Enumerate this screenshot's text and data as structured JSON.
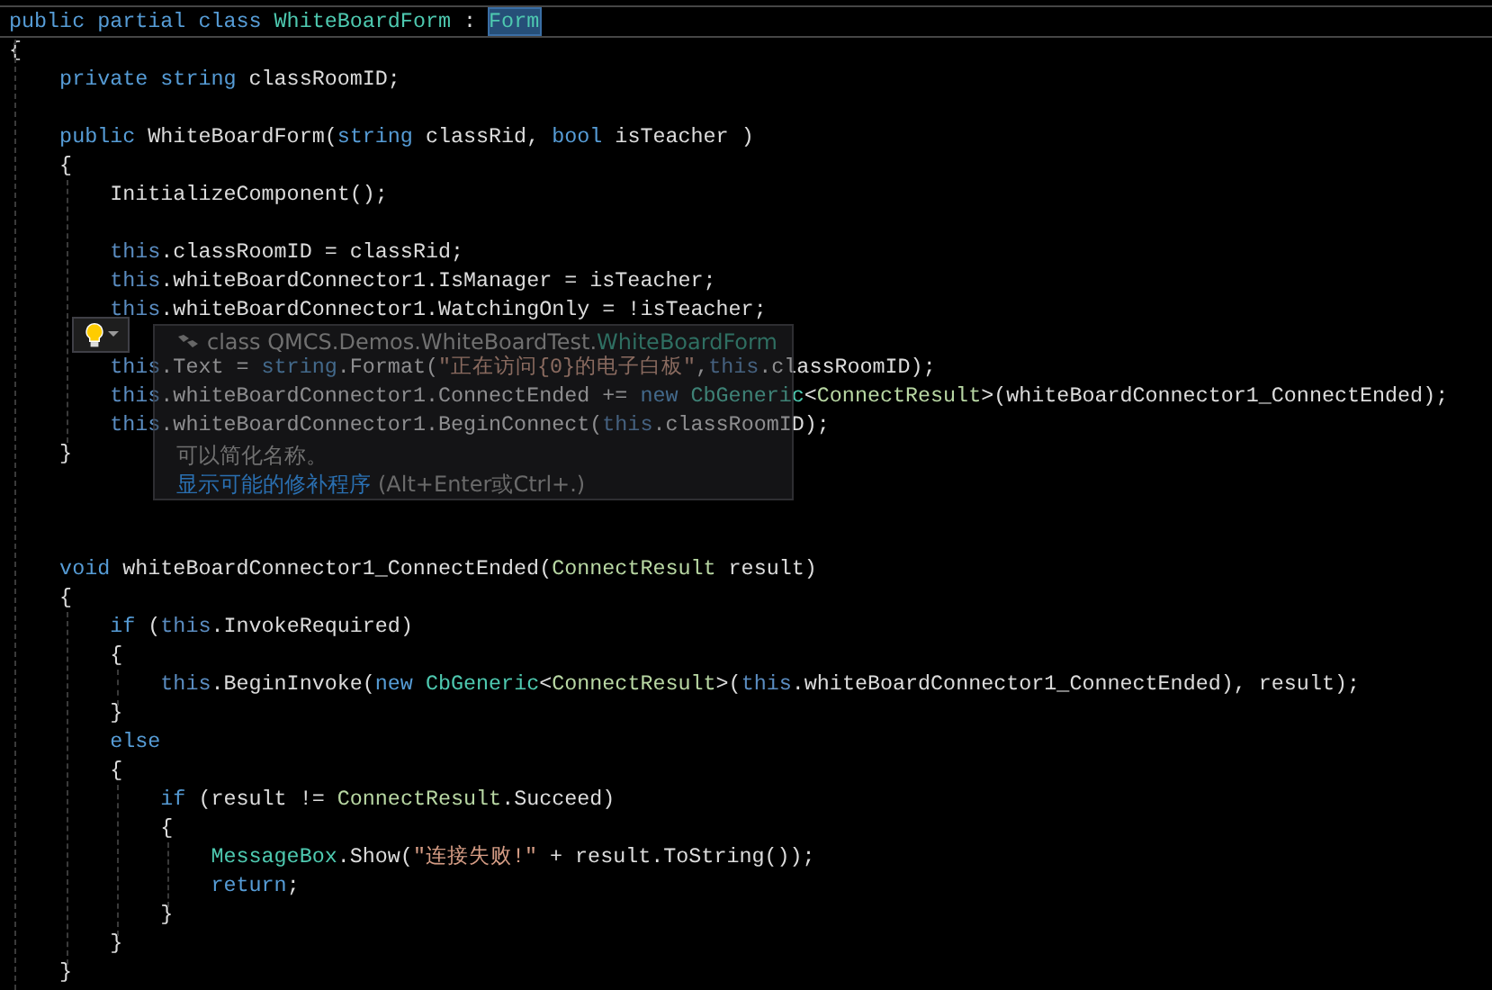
{
  "editor": {
    "lines": [
      {
        "kind": "current",
        "tokens": [
          {
            "text": "public partial class ",
            "kind": "keyword"
          },
          {
            "text": "WhiteBoardForm",
            "kind": "type"
          },
          {
            "text": " : ",
            "kind": "plain"
          },
          {
            "text": "Form",
            "kind": "selected-type"
          }
        ]
      },
      {
        "kind": "code",
        "tokens": [
          {
            "text": "{",
            "kind": "plain"
          }
        ]
      },
      {
        "kind": "code",
        "tokens": [
          {
            "text": "    private string",
            "kind": "keyword"
          },
          {
            "text": " classRoomID;",
            "kind": "plain"
          }
        ]
      },
      {
        "kind": "blank"
      },
      {
        "kind": "code",
        "tokens": [
          {
            "text": "    public",
            "kind": "keyword"
          },
          {
            "text": " WhiteBoardForm(",
            "kind": "plain"
          },
          {
            "text": "string",
            "kind": "keyword"
          },
          {
            "text": " classRid, ",
            "kind": "plain"
          },
          {
            "text": "bool",
            "kind": "keyword"
          },
          {
            "text": " isTeacher )",
            "kind": "plain"
          }
        ]
      },
      {
        "kind": "code",
        "tokens": [
          {
            "text": "    {",
            "kind": "plain"
          }
        ]
      },
      {
        "kind": "code",
        "tokens": [
          {
            "text": "        InitializeComponent();",
            "kind": "plain"
          }
        ]
      },
      {
        "kind": "blank"
      },
      {
        "kind": "code",
        "tokens": [
          {
            "text": "        this",
            "kind": "faded"
          },
          {
            "text": ".classRoomID = classRid;",
            "kind": "plain"
          }
        ]
      },
      {
        "kind": "code",
        "tokens": [
          {
            "text": "        this",
            "kind": "faded"
          },
          {
            "text": ".whiteBoardConnector1.IsManager = isTeacher;",
            "kind": "plain"
          }
        ]
      },
      {
        "kind": "code",
        "tokens": [
          {
            "text": "        this",
            "kind": "faded"
          },
          {
            "text": ".whiteBoardConnector1.WatchingOnly = !isTeacher;",
            "kind": "plain"
          }
        ]
      },
      {
        "kind": "blank"
      },
      {
        "kind": "code",
        "tokens": [
          {
            "text": "        this",
            "kind": "faded"
          },
          {
            "text": ".Text = ",
            "kind": "plain"
          },
          {
            "text": "string",
            "kind": "keyword"
          },
          {
            "text": ".Format(",
            "kind": "plain"
          },
          {
            "text": "\"正在访问{0}的电子白板\"",
            "kind": "string"
          },
          {
            "text": ",",
            "kind": "plain"
          },
          {
            "text": "this",
            "kind": "faded"
          },
          {
            "text": ".classRoomID);",
            "kind": "plain"
          }
        ]
      },
      {
        "kind": "code",
        "tokens": [
          {
            "text": "        this",
            "kind": "faded"
          },
          {
            "text": ".whiteBoardConnector1.ConnectEnded += ",
            "kind": "plain"
          },
          {
            "text": "new ",
            "kind": "keyword"
          },
          {
            "text": "CbGeneric",
            "kind": "type"
          },
          {
            "text": "<",
            "kind": "plain"
          },
          {
            "text": "ConnectResult",
            "kind": "struct"
          },
          {
            "text": ">(whiteBoardConnector1_ConnectEnded);",
            "kind": "plain"
          }
        ]
      },
      {
        "kind": "code",
        "tokens": [
          {
            "text": "        this",
            "kind": "faded"
          },
          {
            "text": ".whiteBoardConnector1.BeginConnect(",
            "kind": "plain"
          },
          {
            "text": "this",
            "kind": "faded"
          },
          {
            "text": ".classRoomID);",
            "kind": "plain"
          }
        ]
      },
      {
        "kind": "code",
        "tokens": [
          {
            "text": "    }",
            "kind": "plain"
          }
        ]
      },
      {
        "kind": "blank"
      },
      {
        "kind": "blank"
      },
      {
        "kind": "blank"
      },
      {
        "kind": "code",
        "tokens": [
          {
            "text": "    void",
            "kind": "keyword"
          },
          {
            "text": " whiteBoardConnector1_ConnectEnded(",
            "kind": "plain"
          },
          {
            "text": "ConnectResult",
            "kind": "struct"
          },
          {
            "text": " result)",
            "kind": "plain"
          }
        ]
      },
      {
        "kind": "code",
        "tokens": [
          {
            "text": "    {",
            "kind": "plain"
          }
        ]
      },
      {
        "kind": "code",
        "tokens": [
          {
            "text": "        if",
            "kind": "keyword"
          },
          {
            "text": " (",
            "kind": "plain"
          },
          {
            "text": "this",
            "kind": "faded"
          },
          {
            "text": ".InvokeRequired)",
            "kind": "plain"
          }
        ]
      },
      {
        "kind": "code",
        "tokens": [
          {
            "text": "        {",
            "kind": "plain"
          }
        ]
      },
      {
        "kind": "code",
        "tokens": [
          {
            "text": "            this",
            "kind": "faded"
          },
          {
            "text": ".BeginInvoke(",
            "kind": "plain"
          },
          {
            "text": "new ",
            "kind": "keyword"
          },
          {
            "text": "CbGeneric",
            "kind": "type"
          },
          {
            "text": "<",
            "kind": "plain"
          },
          {
            "text": "ConnectResult",
            "kind": "struct"
          },
          {
            "text": ">(",
            "kind": "plain"
          },
          {
            "text": "this",
            "kind": "faded"
          },
          {
            "text": ".whiteBoardConnector1_ConnectEnded), result);",
            "kind": "plain"
          }
        ]
      },
      {
        "kind": "code",
        "tokens": [
          {
            "text": "        }",
            "kind": "plain"
          }
        ]
      },
      {
        "kind": "code",
        "tokens": [
          {
            "text": "        else",
            "kind": "keyword"
          }
        ]
      },
      {
        "kind": "code",
        "tokens": [
          {
            "text": "        {",
            "kind": "plain"
          }
        ]
      },
      {
        "kind": "code",
        "tokens": [
          {
            "text": "            if",
            "kind": "keyword"
          },
          {
            "text": " (result != ",
            "kind": "plain"
          },
          {
            "text": "ConnectResult",
            "kind": "struct"
          },
          {
            "text": ".Succeed)",
            "kind": "plain"
          }
        ]
      },
      {
        "kind": "code",
        "tokens": [
          {
            "text": "            {",
            "kind": "plain"
          }
        ]
      },
      {
        "kind": "code",
        "tokens": [
          {
            "text": "                MessageBox",
            "kind": "type"
          },
          {
            "text": ".Show(",
            "kind": "plain"
          },
          {
            "text": "\"连接失败!\"",
            "kind": "string"
          },
          {
            "text": " + result.ToString());",
            "kind": "plain"
          }
        ]
      },
      {
        "kind": "code",
        "tokens": [
          {
            "text": "                return",
            "kind": "keyword"
          },
          {
            "text": ";",
            "kind": "plain"
          }
        ]
      },
      {
        "kind": "code",
        "tokens": [
          {
            "text": "            }",
            "kind": "plain"
          }
        ]
      },
      {
        "kind": "code",
        "tokens": [
          {
            "text": "        }",
            "kind": "plain"
          }
        ]
      },
      {
        "kind": "code",
        "tokens": [
          {
            "text": "    }",
            "kind": "plain"
          }
        ]
      }
    ]
  },
  "quick_info": {
    "title_prefix": "class QMCS.Demos.WhiteBoardTest.",
    "title_type": "WhiteBoardForm",
    "message": "可以简化名称。",
    "link": "显示可能的修补程序",
    "shortcut": "(Alt+Enter或Ctrl+.)"
  }
}
